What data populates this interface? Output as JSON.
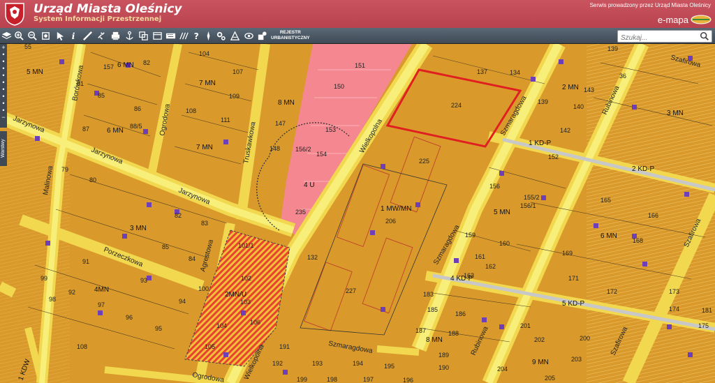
{
  "header": {
    "title": "Urząd Miasta Oleśnicy",
    "subtitle": "System Informacji Przestrzennej",
    "service_note": "Serwis prowadzony przez Urząd Miasta Oleśnicy",
    "brand": "e-mapa"
  },
  "toolbar": {
    "registry_line1": "REJESTR",
    "registry_line2": "URBANISTYCZNY",
    "search_placeholder": "Szukaj..."
  },
  "sidebar": {
    "layers_label": "Warstwy"
  },
  "map": {
    "zones": [
      "5 MN",
      "6 MN",
      "7 MN",
      "8 MN",
      "6 MN",
      "3 MN",
      "4MN",
      "7 MN",
      "2MN/U",
      "4 U",
      "1 MW/MN",
      "5 MN",
      "6 MN",
      "3 MN",
      "2 MN",
      "8 MN",
      "9 MN",
      "1 KD-P",
      "2 KD-P",
      "4 KD-P",
      "5 KD-P",
      "1 KDW"
    ],
    "streets": [
      "Jarzynowa",
      "Jarzynowa",
      "Jarzynowa",
      "Malinowa",
      "Porzeczkowa",
      "Truskawkowa",
      "Agrestowa",
      "Wielkopolna",
      "Wielkopolna",
      "Szmaragdowa",
      "Szmaragdowa",
      "Szmaragdowa",
      "Rubinowa",
      "Rubinowa",
      "Szafirowa",
      "Szafirowa",
      "Borówkowa",
      "Ogrodowa",
      "Ogrodowa",
      "Szafirowa"
    ],
    "parcels": [
      "55",
      "104",
      "151",
      "139",
      "36",
      "157",
      "82",
      "107",
      "150",
      "224",
      "137",
      "134",
      "143",
      "140",
      "81",
      "85",
      "86",
      "108",
      "109",
      "147",
      "153",
      "225",
      "139",
      "142",
      "87",
      "88/5",
      "111",
      "154",
      "148",
      "227",
      "152",
      "165",
      "166",
      "168",
      "169",
      "171",
      "172",
      "173",
      "174",
      "175",
      "79",
      "80",
      "82",
      "83",
      "84",
      "85",
      "91",
      "92",
      "93",
      "94",
      "95",
      "96",
      "97",
      "98",
      "99",
      "100",
      "101/1",
      "102",
      "103",
      "104",
      "105",
      "106",
      "108",
      "132",
      "159",
      "160",
      "161",
      "162",
      "163",
      "181",
      "183",
      "185",
      "186",
      "187",
      "188",
      "189",
      "190",
      "191",
      "192",
      "193",
      "194",
      "195",
      "196",
      "197",
      "198",
      "199",
      "200",
      "201",
      "202",
      "203",
      "204",
      "205",
      "206",
      "235",
      "156",
      "155/2",
      "156/1",
      "156/2",
      "149"
    ],
    "colors": {
      "mn_zone": "#d99a2b",
      "service_zone": "#f4878f",
      "road": "#f7ea64",
      "road_edge": "#f2d84f",
      "selection": "#e02020",
      "building": "#6f3fb5",
      "stripe": "#e8432e"
    }
  }
}
